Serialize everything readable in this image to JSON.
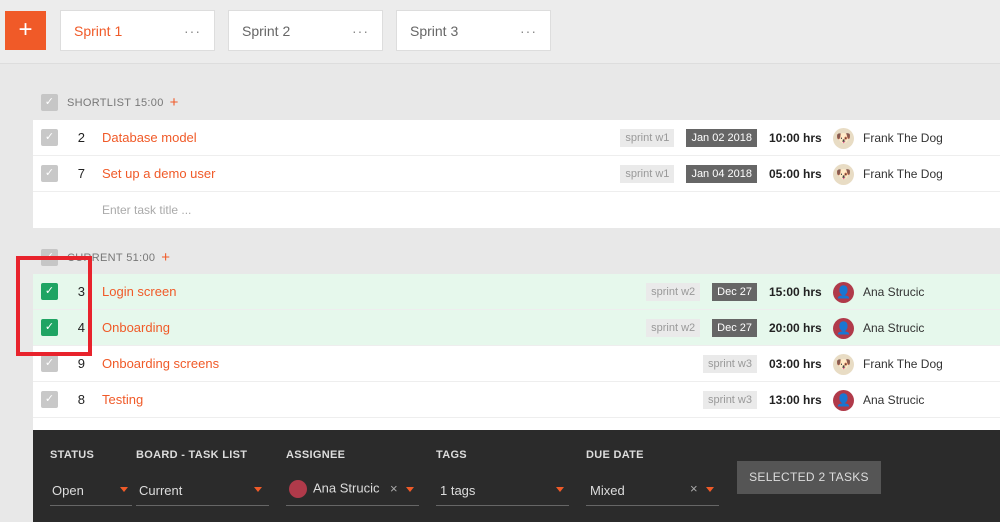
{
  "toolbar": {
    "add_label": "+"
  },
  "tabs": [
    {
      "label": "Sprint 1",
      "menu": "···"
    },
    {
      "label": "Sprint 2",
      "menu": "···"
    },
    {
      "label": "Sprint 3",
      "menu": "···"
    }
  ],
  "shortlist": {
    "name": "SHORTLIST",
    "time": "15:00",
    "add": "+",
    "tasks": [
      {
        "num": "2",
        "title": "Database model",
        "tag": "sprint w1",
        "date": "Jan 02 2018",
        "hours": "10:00 hrs",
        "assignee": "Frank The Dog"
      },
      {
        "num": "7",
        "title": "Set up a demo user",
        "tag": "sprint w1",
        "date": "Jan 04 2018",
        "hours": "05:00 hrs",
        "assignee": "Frank The Dog"
      }
    ],
    "placeholder": "Enter task title ..."
  },
  "current": {
    "name": "CURRENT",
    "time": "51:00",
    "add": "+",
    "tasks": [
      {
        "num": "3",
        "title": "Login screen",
        "tag": "sprint w2",
        "date": "Dec 27",
        "hours": "15:00 hrs",
        "assignee": "Ana Strucic",
        "checked": true
      },
      {
        "num": "4",
        "title": "Onboarding",
        "tag": "sprint w2",
        "date": "Dec 27",
        "hours": "20:00 hrs",
        "assignee": "Ana Strucic",
        "checked": true
      },
      {
        "num": "9",
        "title": "Onboarding screens",
        "tag": "sprint w3",
        "date": "",
        "hours": "03:00 hrs",
        "assignee": "Frank The Dog",
        "checked": false
      },
      {
        "num": "8",
        "title": "Testing",
        "tag": "sprint w3",
        "date": "",
        "hours": "13:00 hrs",
        "assignee": "Ana Strucic",
        "checked": false
      }
    ]
  },
  "icons": {
    "check": "✓",
    "dog": "🐶",
    "ana": "👤",
    "clear": "×"
  },
  "bulk": {
    "status": {
      "label": "STATUS",
      "value": "Open"
    },
    "board": {
      "label": "BOARD - TASK LIST",
      "value": "Current"
    },
    "assignee": {
      "label": "ASSIGNEE",
      "value": "Ana Strucic"
    },
    "tags": {
      "label": "TAGS",
      "value": "1 tags"
    },
    "due": {
      "label": "DUE DATE",
      "value": "Mixed"
    },
    "button": "SELECTED 2 TASKS"
  },
  "colors": {
    "accent": "#f05a28",
    "selected_row": "#e6f8ec",
    "check_on": "#1fa463",
    "bulk_bar": "#2b2b2b"
  }
}
